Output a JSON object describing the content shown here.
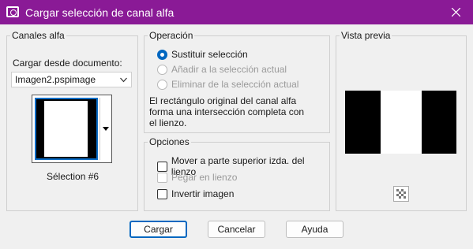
{
  "window": {
    "title": "Cargar selección de canal alfa",
    "title_bar_color": "#8a1a96",
    "accent": "#0067c0"
  },
  "left": {
    "label": "Canales alfa",
    "load_from_label": "Cargar desde documento:",
    "document_value": "Imagen2.pspimage",
    "selection_label": "Sélection #6"
  },
  "operation": {
    "label": "Operación",
    "options": [
      "Sustituir selección",
      "Añadir a la selección actual",
      "Eliminar de la selección actual"
    ],
    "selected_index": 0,
    "description": [
      "El rectángulo original del canal alfa",
      "forma una intersección completa con",
      "el lienzo."
    ]
  },
  "options": {
    "label": "Opciones",
    "move": "Mover a parte superior izda. del lienzo",
    "paste": "Pegar en lienzo",
    "invert": "Invertir imagen"
  },
  "preview": {
    "label": "Vista previa"
  },
  "buttons": {
    "load": "Cargar",
    "cancel": "Cancelar",
    "help": "Ayuda"
  }
}
